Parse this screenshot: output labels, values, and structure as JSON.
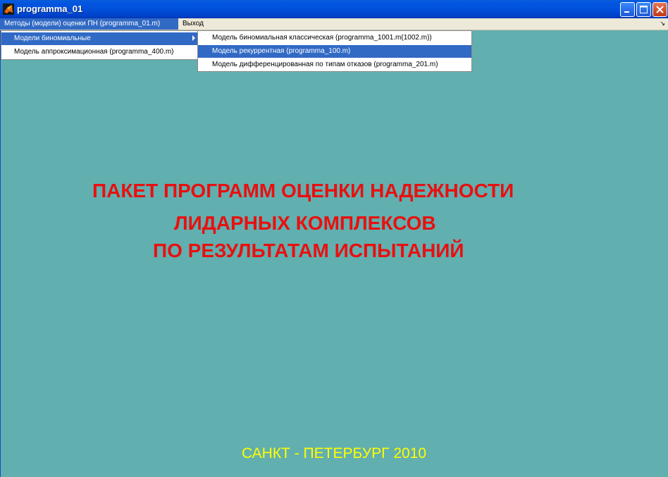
{
  "window": {
    "title": "programma_01",
    "app_icon": "matlab-icon",
    "controls": [
      "minimize-icon",
      "maximize-icon",
      "close-icon"
    ]
  },
  "menubar": {
    "items": [
      {
        "label": "Методы (модели) оценки ПН (programma_01.m)",
        "open": true
      },
      {
        "label": "Выход",
        "open": false
      }
    ],
    "resize_glyph": "↘"
  },
  "dropdown": {
    "items": [
      {
        "label": "Модели биномиальные",
        "has_submenu": true,
        "highlighted": true
      },
      {
        "label": "Модель аппроксимационная (programma_400.m)",
        "has_submenu": false,
        "highlighted": false
      }
    ]
  },
  "submenu": {
    "items": [
      {
        "label": "Модель биномиальная  классическая (programma_1001.m(1002.m))",
        "highlighted": false
      },
      {
        "label": "Модель рекуррентная  (programma_100.m)",
        "highlighted": true
      },
      {
        "label": "Модель дифференцированная по типам отказов (programma_201.m)",
        "highlighted": false
      }
    ]
  },
  "content": {
    "title_lines": [
      "ПАКЕТ ПРОГРАММ ОЦЕНКИ НАДЕЖНОСТИ",
      "ЛИДАРНЫХ КОМПЛЕКСОВ",
      "ПО РЕЗУЛЬТАТАМ ИСПЫТАНИЙ"
    ],
    "footer": "САНКТ - ПЕТЕРБУРГ 2010"
  },
  "colors": {
    "background": "#62AFAF",
    "title_text": "#E81010",
    "footer_text": "#FFFF00",
    "highlight": "#316AC5",
    "titlebar": "#0050DC"
  }
}
